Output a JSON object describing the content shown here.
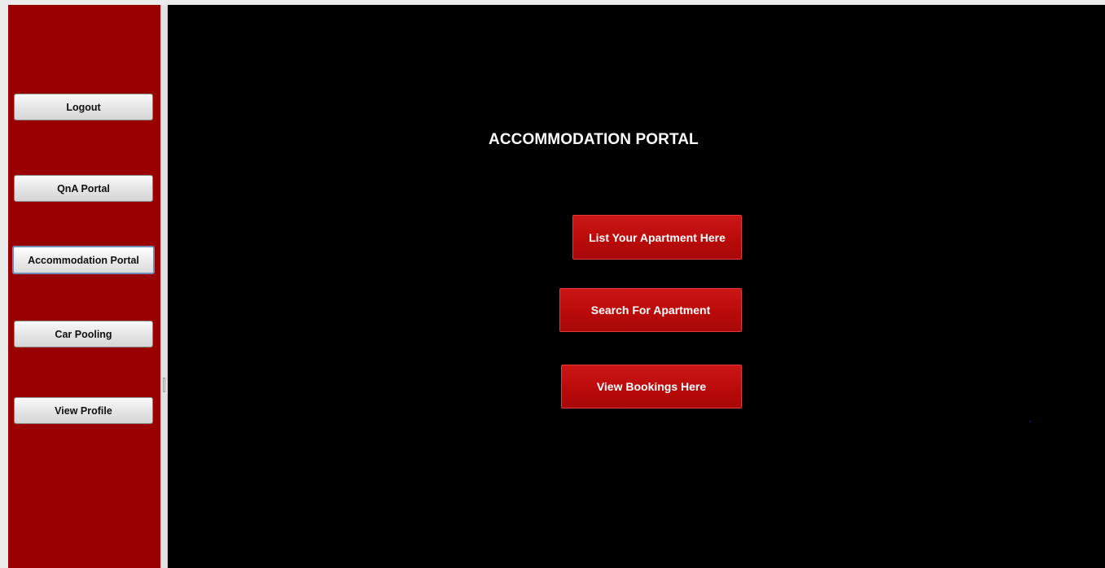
{
  "sidebar": {
    "buttons": [
      {
        "label": "Logout"
      },
      {
        "label": "QnA Portal"
      },
      {
        "label": "Accommodation Portal",
        "selected": true
      },
      {
        "label": "Car Pooling"
      },
      {
        "label": "View Profile"
      }
    ],
    "background_color": "#990000"
  },
  "main": {
    "title": "ACCOMMODATION PORTAL",
    "background_color": "#000000",
    "actions": {
      "list_apartment": "List Your Apartment Here",
      "search_apartment": "Search For Apartment",
      "view_bookings": "View Bookings Here"
    },
    "action_color": "#b80a0a"
  }
}
